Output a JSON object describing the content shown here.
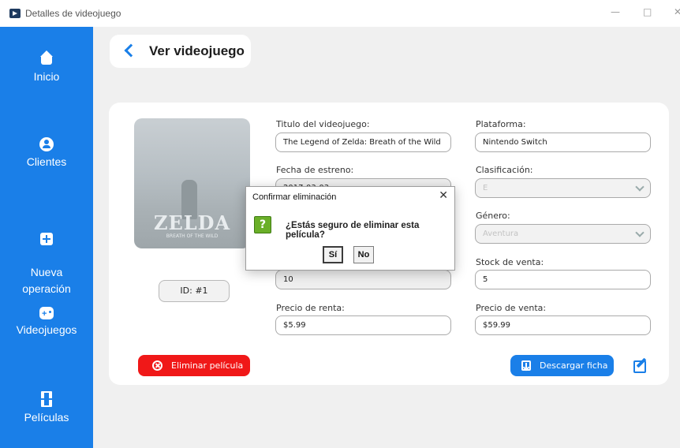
{
  "window": {
    "title": "Detalles de videojuego",
    "controls": {
      "minimize": "—",
      "maximize": "□",
      "close": "✕"
    }
  },
  "sidebar": {
    "items": [
      {
        "label": "Inicio",
        "icon": "home-icon"
      },
      {
        "label": "Clientes",
        "icon": "user-icon"
      },
      {
        "label": "Nueva\noperación",
        "icon": "plus-icon"
      },
      {
        "label": "Videojuegos",
        "icon": "gamepad-icon"
      },
      {
        "label": "Películas",
        "icon": "film-icon"
      }
    ],
    "color": "#1a7fe8"
  },
  "header": {
    "title": "Ver videojuego",
    "back_icon": "chevron-left-icon"
  },
  "game": {
    "cover_logo": "ZELDA",
    "cover_sub": "BREATH OF THE WILD",
    "id_label": "ID: #1",
    "fields": {
      "title": {
        "label": "Titulo del videojuego:",
        "value": "The Legend of Zelda: Breath of the Wild"
      },
      "platform": {
        "label": "Plataforma:",
        "value": "Nintendo Switch"
      },
      "release_date": {
        "label": "Fecha de estreno:",
        "value": "2017-03-03"
      },
      "classification": {
        "label": "Clasificación:",
        "value": "E"
      },
      "genre": {
        "label": "Género:",
        "value": "Aventura"
      },
      "stock_rent": {
        "value": "10"
      },
      "stock_sale": {
        "label": "Stock de venta:",
        "value": "5"
      },
      "rent_price": {
        "label": "Precio de renta:",
        "value": "$5.99"
      },
      "sale_price": {
        "label": "Precio de venta:",
        "value": "$59.99"
      }
    }
  },
  "actions": {
    "delete_label": "Eliminar película",
    "download_label": "Descargar ficha",
    "delete_color": "#f01818",
    "accent_color": "#1a7fe8"
  },
  "dialog": {
    "title": "Confirmar eliminación",
    "close": "✕",
    "icon": "question-icon",
    "icon_glyph": "?",
    "message": "¿Estás seguro de eliminar esta película?",
    "yes_label": "Sí",
    "no_label": "No"
  }
}
